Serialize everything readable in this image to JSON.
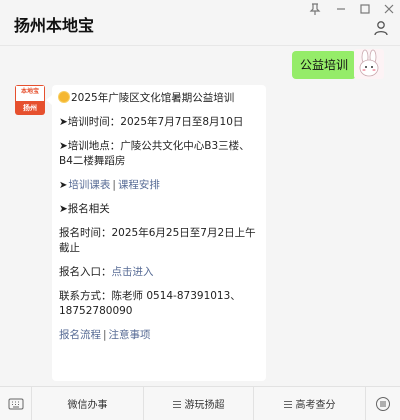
{
  "app": {
    "title": "扬州本地宝"
  },
  "window_controls": [
    "pin-icon",
    "minimize-icon",
    "maximize-icon",
    "close-icon"
  ],
  "my_message": {
    "text": "公益培训"
  },
  "account": {
    "avatar_brand": "本地宝",
    "avatar_city": "扬州"
  },
  "article": {
    "title": "2025年广陵区文化馆暑期公益培训",
    "time_line": "➤培训时间：2025年7月7日至8月10日",
    "place_line": "➤培训地点：广陵公共文化中心B3三楼、B4二楼舞蹈房",
    "link_schedule": "培训课表",
    "link_course": "课程安排",
    "signup_related": "➤报名相关",
    "signup_time": "报名时间：2025年6月25日至7月2日上午截止",
    "signup_entry_label": "报名入口：",
    "signup_entry_link": "点击进入",
    "contact": "联系方式：陈老师  0514-87391013、18752780090",
    "link_process": "报名流程",
    "link_notice": "注意事项"
  },
  "menu": {
    "items": [
      {
        "label": "微信办事"
      },
      {
        "label": "游玩扬超"
      },
      {
        "label": "高考查分"
      }
    ]
  },
  "colors": {
    "my_bubble": "#95ec69",
    "link": "#576b95",
    "brand": "#e6502e"
  }
}
